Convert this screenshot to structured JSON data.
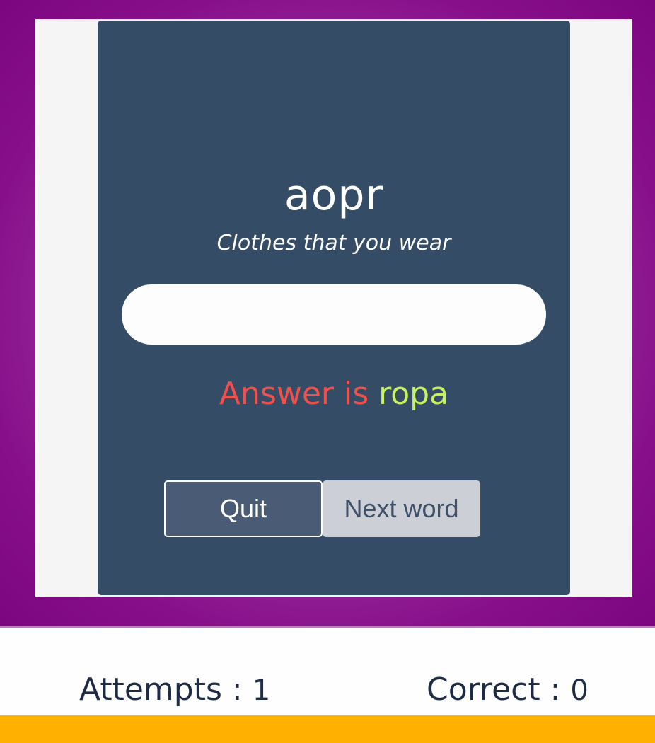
{
  "game": {
    "scrambled_word": "aopr",
    "hint": "Clothes that you wear",
    "answer_input": {
      "value": "",
      "placeholder": ""
    },
    "result": {
      "prefix": "Answer is",
      "answer": "ropa",
      "prefix_color": "#f1514a",
      "answer_color": "#c7f062"
    },
    "buttons": {
      "quit_label": "Quit",
      "next_label": "Next word"
    }
  },
  "stats": {
    "attempts_label": "Attempts :",
    "attempts_value": "1",
    "correct_label": "Correct :",
    "correct_value": "0"
  },
  "colors": {
    "background_purple": "#87108a",
    "card": "#344c65",
    "footer_bar": "#ffb000"
  }
}
